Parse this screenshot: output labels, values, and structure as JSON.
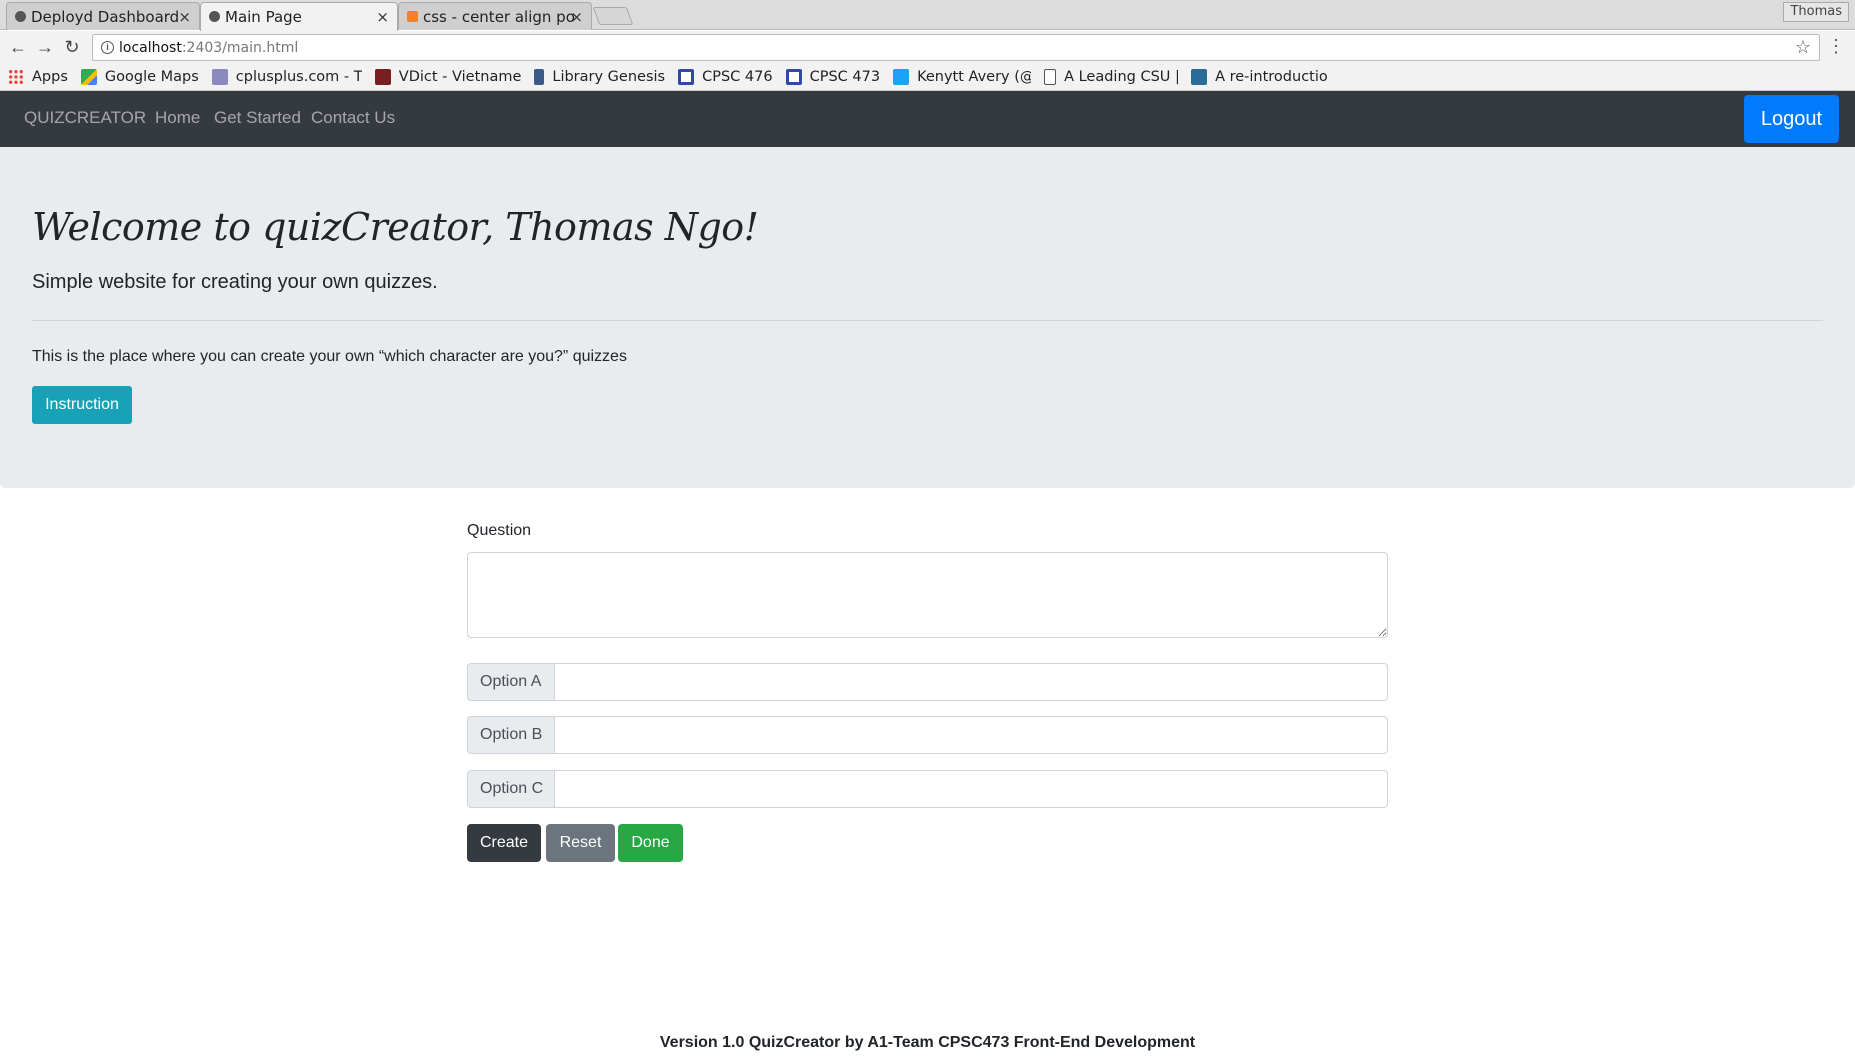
{
  "browser": {
    "tabs": [
      {
        "title": "Deployd Dashboard",
        "close": "×"
      },
      {
        "title": "Main Page",
        "close": "×"
      },
      {
        "title": "css - center align po",
        "close": "×"
      }
    ],
    "profile_name": "Thomas",
    "url_host": "localhost",
    "url_path": ":2403/main.html",
    "nav": {
      "back": "←",
      "forward": "→",
      "reload": "↻",
      "star": "☆",
      "menu": "⋮"
    },
    "bookmarks": [
      {
        "label": "Apps",
        "icon": "apps-grid-icon"
      },
      {
        "label": "Google Maps",
        "icon": "google-maps-icon"
      },
      {
        "label": "cplusplus.com - T",
        "icon": "cplusplus-icon"
      },
      {
        "label": "VDict - Vietname",
        "icon": "vdict-icon"
      },
      {
        "label": "Library Genesis",
        "icon": "library-genesis-icon"
      },
      {
        "label": "CPSC 476",
        "icon": "calendar-icon"
      },
      {
        "label": "CPSC 473",
        "icon": "calendar-icon"
      },
      {
        "label": "Kenytt Avery (@",
        "icon": "twitter-icon"
      },
      {
        "label": "A Leading CSU | C",
        "icon": "document-icon"
      },
      {
        "label": "A re-introductio",
        "icon": "mdn-icon"
      }
    ]
  },
  "navbar": {
    "brand": "QUIZCREATOR",
    "links": [
      "Home",
      "Get Started",
      "Contact Us"
    ],
    "logout": "Logout"
  },
  "jumbotron": {
    "welcome": "Welcome to quizCreator, Thomas Ngo!",
    "lead": "Simple website for creating your own quizzes.",
    "text": "This is the place where you can create your own “which character are you?” quizzes",
    "instruction_button": "Instruction"
  },
  "form": {
    "question_label": "Question",
    "question_value": "",
    "options": [
      {
        "label": "Option A",
        "value": ""
      },
      {
        "label": "Option B",
        "value": ""
      },
      {
        "label": "Option C",
        "value": ""
      }
    ],
    "buttons": {
      "create": "Create",
      "reset": "Reset",
      "done": "Done"
    }
  },
  "footer": "Version 1.0 QuizCreator by A1-Team CPSC473 Front-End Development",
  "colors": {
    "navbar_bg": "#343a40",
    "jumbotron_bg": "#e9ecef",
    "primary": "#007bff",
    "info": "#17a2b8",
    "secondary": "#6c757d",
    "success": "#28a745"
  }
}
